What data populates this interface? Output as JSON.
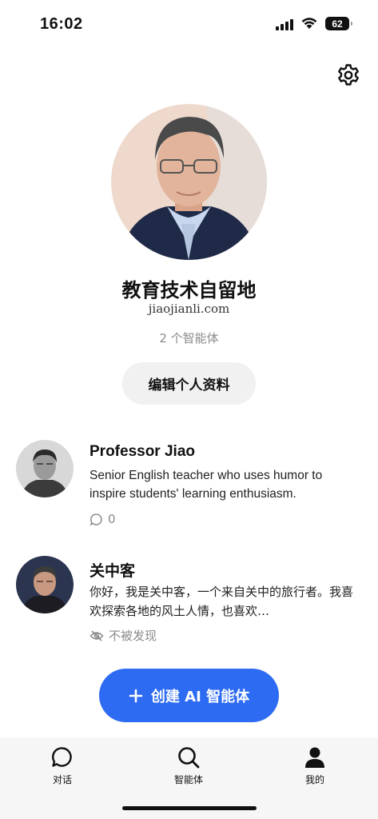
{
  "status_bar": {
    "time": "16:02",
    "battery": "62"
  },
  "profile": {
    "name": "教育技术自留地",
    "domain": "jiaojianli.com",
    "agent_count": "2 个智能体",
    "edit_button": "编辑个人资料"
  },
  "agents": [
    {
      "title": "Professor Jiao",
      "description": "Senior English teacher who uses humor to inspire students' learning enthusiasm.",
      "meta_text": "0",
      "meta_icon": "chat-bubble-icon"
    },
    {
      "title": "关中客",
      "description": "你好，我是关中客，一个来自关中的旅行者。我喜欢探索各地的风土人情，也喜欢…",
      "meta_text": "不被发现",
      "meta_icon": "eye-off-icon"
    }
  ],
  "create_button": {
    "label": "创建 AI 智能体",
    "color": "#2d6bf2"
  },
  "tab_bar": {
    "tabs": [
      {
        "label": "对话",
        "icon": "chat-bubble-icon"
      },
      {
        "label": "智能体",
        "icon": "search-icon"
      },
      {
        "label": "我的",
        "icon": "person-icon"
      }
    ]
  }
}
